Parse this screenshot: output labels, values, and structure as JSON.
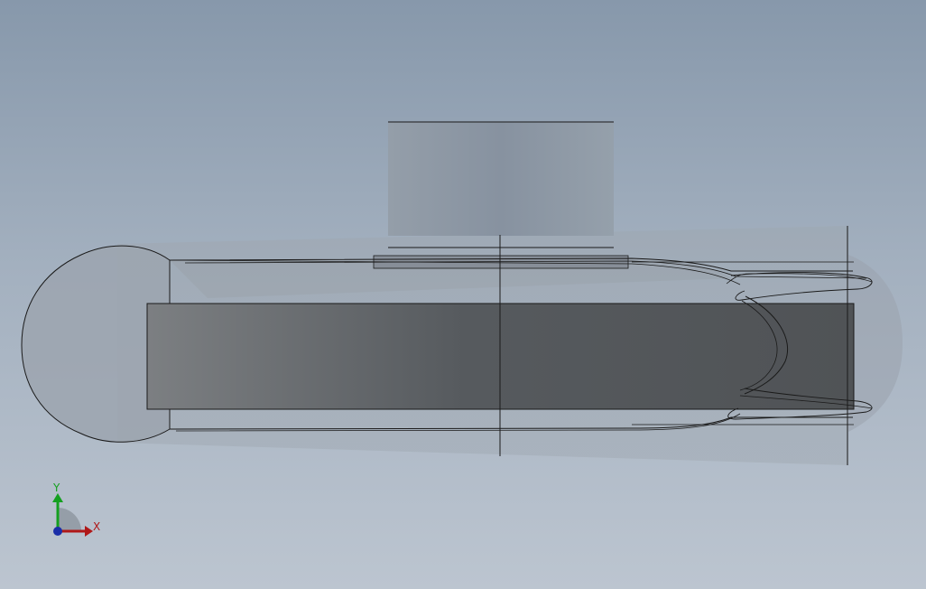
{
  "viewport": {
    "background_top": "#8798ab",
    "background_bottom": "#bcc5d0"
  },
  "triad": {
    "x_label": "X",
    "y_label": "Y",
    "x_color": "#b01818",
    "y_color": "#14a020",
    "origin_color": "#1a2ea8"
  },
  "model": {
    "edge_color": "#1a1a1a",
    "body_fill": "#9aa3ad",
    "core_dark": "#4e5155",
    "core_light": "#7a7d80",
    "block_fill": "#8d98a4"
  }
}
